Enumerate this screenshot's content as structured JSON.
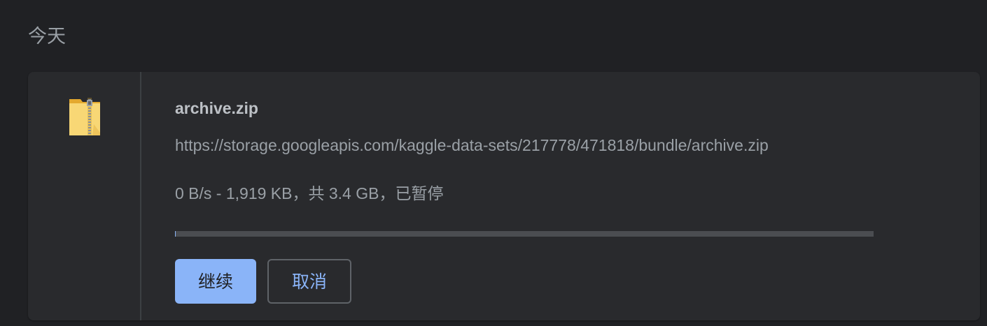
{
  "section": {
    "title": "今天"
  },
  "download": {
    "filename": "archive.zip",
    "url": "https://storage.googleapis.com/kaggle-data-sets/217778/471818/bundle/archive.zip",
    "status": "0 B/s - 1,919 KB，共 3.4 GB，已暂停",
    "progress": 0.0005,
    "icon": "zip-folder-icon"
  },
  "actions": {
    "resume_label": "继续",
    "cancel_label": "取消"
  },
  "colors": {
    "background": "#202124",
    "card": "#292a2d",
    "accent": "#8ab4f8",
    "folder": "#f6c750"
  }
}
